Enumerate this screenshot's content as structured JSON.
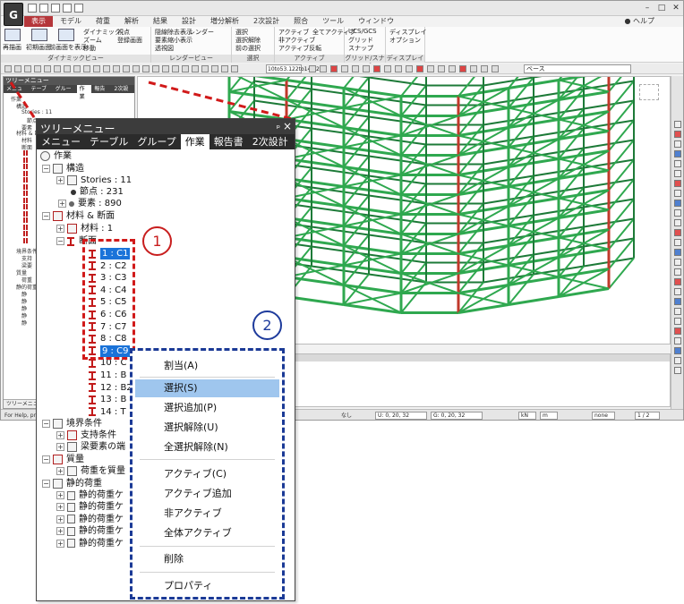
{
  "app": {
    "logo_text": "G",
    "window_title": "",
    "help_label": "ヘルプ",
    "menu_tabs": [
      "表示",
      "モデル",
      "荷重",
      "解析",
      "結果",
      "設計",
      "増分解析",
      "2次設計",
      "照合",
      "ツール",
      "ウィンドウ"
    ],
    "active_menu_tab": "表示"
  },
  "ribbon": {
    "groups": [
      {
        "label": "ダイナミックビュー",
        "buttons": [
          "再描画",
          "初期画面",
          "前画面を表示",
          "ダイナミック",
          "ズーム",
          "移動",
          "視点",
          "登録画面"
        ]
      },
      {
        "label": "レンダービュー",
        "buttons": [
          "隠線除去表示",
          "要素縮小表示",
          "透視図",
          "レンダー"
        ]
      },
      {
        "label": "選択",
        "buttons": [
          "選択",
          "選択解除",
          "前の選択"
        ]
      },
      {
        "label": "アクティブ",
        "buttons": [
          "アクティブ",
          "非アクティブ",
          "アクティブ反転",
          "全てアクティブ"
        ]
      },
      {
        "label": "グリッド/スナップ",
        "buttons": [
          "UCS/GCS",
          "グリッド",
          "スナップ"
        ]
      },
      {
        "label": "ディスプレイ",
        "buttons": [
          "ディスプレイ",
          "オプション"
        ]
      }
    ],
    "coord_field": "10to53.122to142.2",
    "base_field": "ベース"
  },
  "bg_tree": {
    "title": "ツリーメニュー",
    "tabs": [
      "メニュー",
      "テーブル",
      "グループ",
      "作業",
      "報告書",
      "2次設計"
    ],
    "active_tab": "作業",
    "lines": [
      "作業",
      "構造",
      "Stories : 11",
      "節点 : 231",
      "要素",
      "材料 & 断面",
      "材料",
      "断面",
      "境界条件",
      "支持",
      "梁要",
      "質量",
      "荷重",
      "静的荷重",
      "静",
      "静",
      "静",
      "静",
      "静"
    ],
    "footer": "ツリーメニュー"
  },
  "status_bar": {
    "help": "For Help, press F1",
    "none": "なし",
    "u_coord": "U: 0, 20, 32",
    "g_coord": "G: 0, 20, 32",
    "unit_force": "kN",
    "unit_length": "m",
    "none2": "none",
    "page": "1 / 2"
  },
  "tree_panel": {
    "title": "ツリーメニュー",
    "pin": "ₚ",
    "close": "×",
    "tabs": [
      "メニュー",
      "テーブル",
      "グループ",
      "作業",
      "報告書",
      "2次設計"
    ],
    "active_tab": "作業",
    "root": "作業",
    "structure": {
      "label": "構造",
      "stories": "Stories : 11",
      "nodes": "節点 : 231",
      "elements": "要素 : 890"
    },
    "materials_sections": {
      "label": "材料 & 断面",
      "material": "材料 : 1",
      "section": "断面",
      "sections": [
        "1 : C1",
        "2 : C2",
        "3 : C3",
        "4 : C4",
        "5 : C5",
        "6 : C6",
        "7 : C7",
        "8 : C8",
        "9 : C9",
        "10 : C",
        "11 : B",
        "12 : B2",
        "13 : B",
        "14 : T"
      ],
      "selected_sections": [
        "1 : C1",
        "9 : C9"
      ]
    },
    "boundary": {
      "label": "境界条件",
      "support": "支持条件",
      "beam_end": "梁要素の端"
    },
    "mass": {
      "label": "質量",
      "load_to_mass": "荷重を質量"
    },
    "static_load": {
      "label": "静的荷重",
      "cases": [
        "静的荷重ケ",
        "静的荷重ケ",
        "静的荷重ケ",
        "静的荷重ケ",
        "静的荷重ケ"
      ]
    }
  },
  "callouts": {
    "marker_1": "1",
    "marker_2": "2",
    "red_color": "#d11a1a",
    "blue_color": "#1b3a96"
  },
  "context_menu": {
    "items": [
      "割当(A)",
      "選択(S)",
      "選択追加(P)",
      "選択解除(U)",
      "全選択解除(N)",
      "アクティブ(C)",
      "アクティブ追加",
      "非アクティブ",
      "全体アクティブ",
      "削除",
      "プロパティ"
    ],
    "highlighted": "選択(S)"
  }
}
